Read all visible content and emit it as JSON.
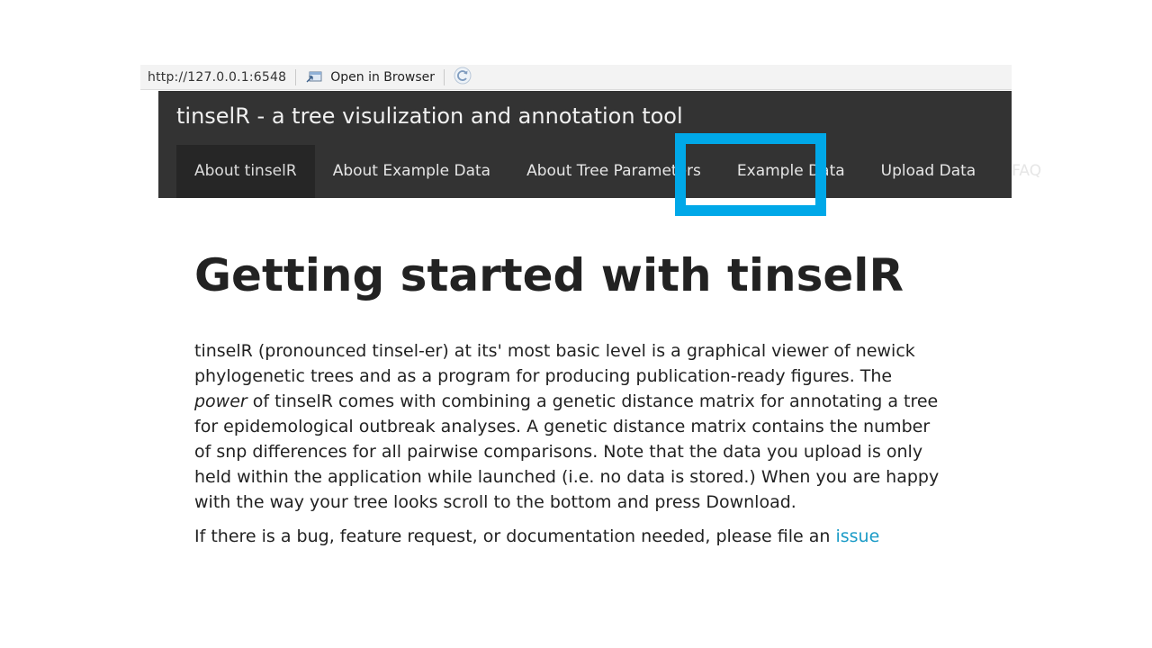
{
  "browser": {
    "url": "http://127.0.0.1:6548",
    "open_in_browser_label": "Open in Browser",
    "icons": {
      "open": "open-in-browser-icon",
      "refresh": "refresh-icon"
    }
  },
  "app": {
    "title": "tinselR - a tree visulization and annotation tool",
    "tabs": [
      {
        "label": "About tinselR",
        "active": true
      },
      {
        "label": "About Example Data",
        "active": false
      },
      {
        "label": "About Tree Parameters",
        "active": false
      },
      {
        "label": "Example Data",
        "active": false
      },
      {
        "label": "Upload Data",
        "active": false
      },
      {
        "label": "FAQ",
        "active": false
      }
    ],
    "highlight_color": "#00a8e8"
  },
  "main": {
    "heading": "Getting started with tinselR",
    "paragraph1": {
      "before_em": "tinselR (pronounced tinsel-er) at its' most basic level is a graphical viewer of newick phylogenetic trees and as a program for producing publication-ready figures. The ",
      "em": "power",
      "after_em": " of tinselR comes with combining a genetic distance matrix for annotating a tree for epidemological outbreak analyses. A genetic distance matrix contains the number of snp differences for all pairwise comparisons. Note that the data you upload is only held within the application while launched (i.e. no data is stored.) When you are happy with the way your tree looks scroll to the bottom and press Download."
    },
    "paragraph2": {
      "text": "If there is a bug, feature request, or documentation needed, please file an ",
      "link": "issue"
    },
    "link_color": "#1a9bc7"
  }
}
